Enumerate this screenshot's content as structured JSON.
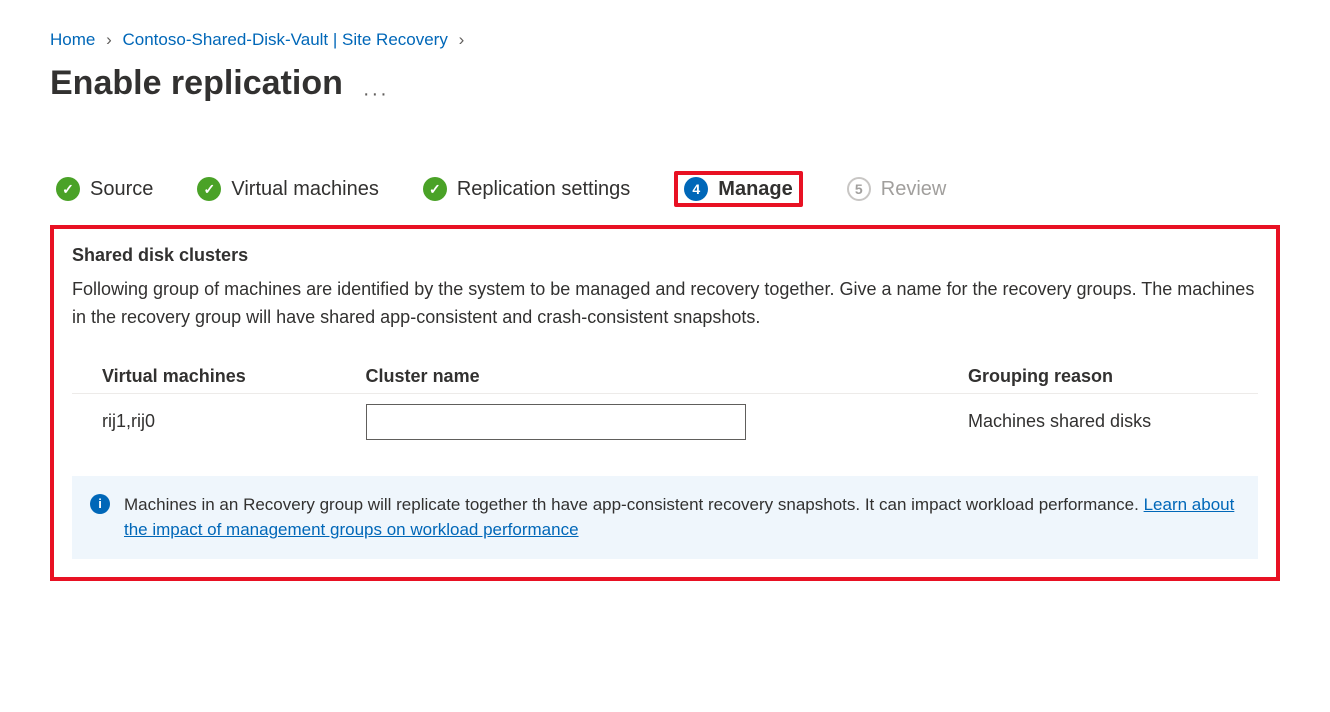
{
  "breadcrumb": {
    "home": "Home",
    "vault": "Contoso-Shared-Disk-Vault | Site Recovery"
  },
  "page_title": "Enable replication",
  "more_label": "···",
  "tabs": {
    "source": "Source",
    "vms": "Virtual machines",
    "replication": "Replication settings",
    "manage_num": "4",
    "manage": "Manage",
    "review_num": "5",
    "review": "Review"
  },
  "section": {
    "heading": "Shared disk clusters",
    "desc": "Following group of machines are identified by the system to be managed and recovery together. Give a name for the recovery groups. The machines in the recovery group will have shared app-consistent and crash-consistent snapshots."
  },
  "table": {
    "headers": {
      "vms": "Virtual machines",
      "cluster": "Cluster name",
      "reason": "Grouping reason"
    },
    "row": {
      "vms": "rij1,rij0",
      "cluster_value": "",
      "reason": "Machines shared disks"
    }
  },
  "info": {
    "text1": "Machines in an Recovery group will replicate together th have app-consistent recovery snapshots. It can impact workload performance. ",
    "link": "Learn about the impact of management groups on workload performance"
  }
}
